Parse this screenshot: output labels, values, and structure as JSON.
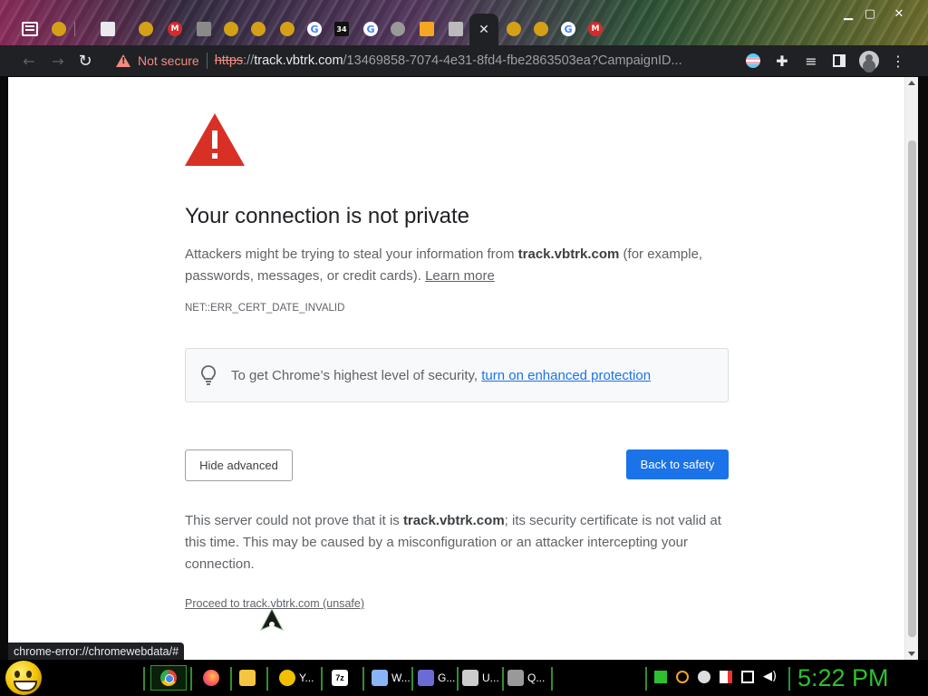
{
  "toolbar": {
    "security_label": "Not secure",
    "url_scheme": "https",
    "url_sep": "://",
    "url_host": "track.vbtrk.com",
    "url_path": "/13469858-7074-4e31-8fd4-fbe2863503ea?CampaignID..."
  },
  "tabs": {
    "active_close": "✕",
    "favicon_texts": [
      "G",
      "G",
      "G",
      "34"
    ]
  },
  "window": {
    "minimize": "▁",
    "maximize": "▢",
    "close": "✕"
  },
  "interstitial": {
    "heading": "Your connection is not private",
    "para1_prefix": "Attackers might be trying to steal your information from ",
    "para1_host": "track.vbtrk.com",
    "para1_suffix": " (for example, passwords, messages, or credit cards). ",
    "learn_more": "Learn more",
    "error_code": "NET::ERR_CERT_DATE_INVALID",
    "enhanced_prefix": "To get Chrome’s highest level of security, ",
    "enhanced_link": "turn on enhanced protection",
    "hide_advanced": "Hide advanced",
    "back_to_safety": "Back to safety",
    "para2_prefix": "This server could not prove that it is ",
    "para2_host": "track.vbtrk.com",
    "para2_suffix": "; its security certificate is not valid at this time. This may be caused by a misconfiguration or an attacker intercepting your connection.",
    "proceed_link": "Proceed to track.vbtrk.com (unsafe)"
  },
  "status_bubble": "chrome-error://chromewebdata/#",
  "taskbar": {
    "items": [
      "Y...",
      "W...",
      "G...",
      "U...",
      "Q..."
    ],
    "clock": "5:22 PM"
  },
  "colors": {
    "primary_button": "#1a73e8",
    "danger": "#d93025",
    "not_secure": "#f28b82",
    "clock": "#2ec02e"
  }
}
